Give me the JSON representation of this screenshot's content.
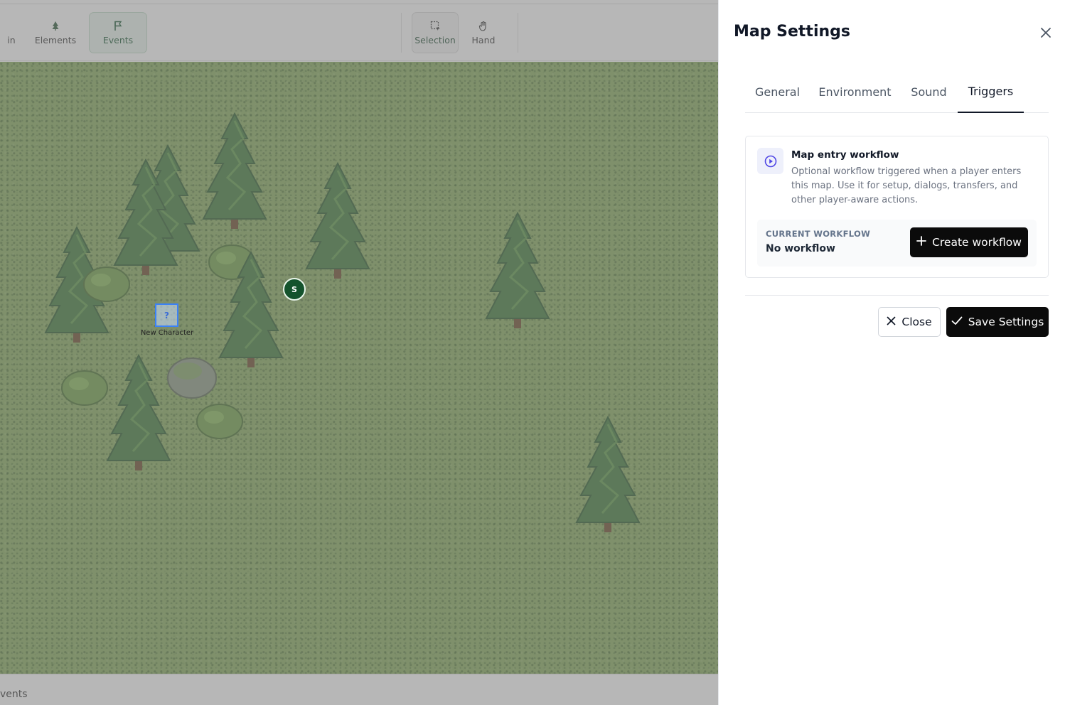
{
  "toolbar": {
    "tools": [
      {
        "label": "in",
        "icon": "brush-icon"
      },
      {
        "label": "Elements",
        "icon": "tree-icon"
      },
      {
        "label": "Events",
        "icon": "flag-icon",
        "active": true
      },
      {
        "label": "Selection",
        "icon": "selection-icon",
        "active": true
      },
      {
        "label": "Hand",
        "icon": "hand-icon"
      }
    ]
  },
  "map": {
    "character": {
      "glyph": "?",
      "label": "New Character"
    },
    "start_marker": "S"
  },
  "statusbar": {
    "text": "vents"
  },
  "panel": {
    "title": "Map Settings",
    "tabs": [
      {
        "label": "General"
      },
      {
        "label": "Environment"
      },
      {
        "label": "Sound"
      },
      {
        "label": "Triggers",
        "active": true
      }
    ],
    "workflow_card": {
      "icon": "play-circle-icon",
      "title": "Map entry workflow",
      "description": "Optional workflow triggered when a player enters this map. Use it for setup, dialogs, transfers, and other player-aware actions.",
      "current_caption": "CURRENT WORKFLOW",
      "current_value": "No workflow",
      "create_label": "Create workflow"
    },
    "close_label": "Close",
    "save_label": "Save Settings"
  },
  "colors": {
    "primary_button": "#0b0b0b",
    "accent_icon": "#4f46e5",
    "map_grass": "#86aa5d",
    "active_tool": "#e7f1ea"
  }
}
